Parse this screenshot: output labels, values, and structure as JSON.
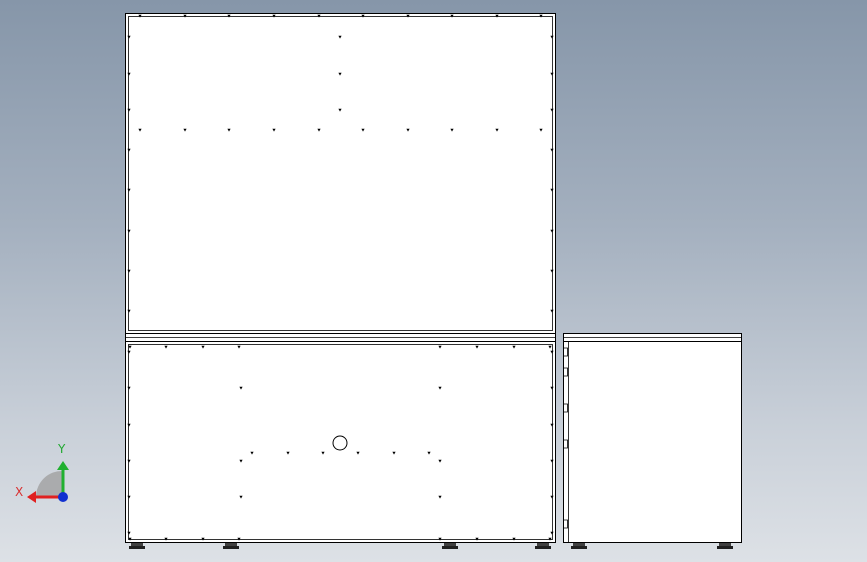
{
  "triad": {
    "x_label": "X",
    "y_label": "Y",
    "x_color": "#e02020",
    "y_color": "#20b030",
    "z_color": "#1030d0"
  },
  "colors": {
    "background_top": "#8696a9",
    "background_bottom": "#dde1e6",
    "panel_fill": "#ffffff",
    "line": "#000000"
  }
}
